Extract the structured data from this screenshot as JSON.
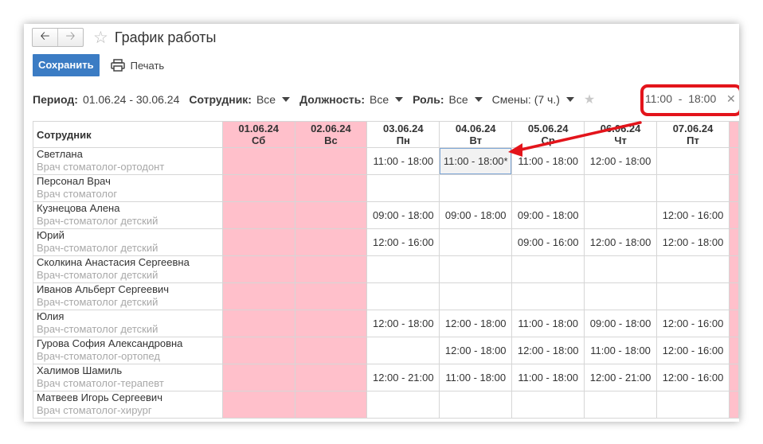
{
  "window": {
    "title": "График работы"
  },
  "toolbar": {
    "save_label": "Сохранить",
    "print_label": "Печать"
  },
  "filters": {
    "period_label": "Период:",
    "period_value": "01.06.24 - 30.06.24",
    "employee_label": "Сотрудник:",
    "employee_value": "Все",
    "position_label": "Должность:",
    "position_value": "Все",
    "role_label": "Роль:",
    "role_value": "Все",
    "shifts_value": "Смены: (7 ч.)",
    "time_value": "11:00  -  18:00"
  },
  "colors": {
    "accent": "#3b7cc4",
    "weekend": "#ffc0cb",
    "highlight": "#e3141b"
  },
  "table": {
    "header_employee": "Сотрудник",
    "days": [
      {
        "date": "01.06.24",
        "dow": "Сб"
      },
      {
        "date": "02.06.24",
        "dow": "Вс"
      },
      {
        "date": "03.06.24",
        "dow": "Пн"
      },
      {
        "date": "04.06.24",
        "dow": "Вт"
      },
      {
        "date": "05.06.24",
        "dow": "Ср"
      },
      {
        "date": "06.06.24",
        "dow": "Чт"
      },
      {
        "date": "07.06.24",
        "dow": "Пт"
      }
    ],
    "rows": [
      {
        "name": "Светлана",
        "position": "Врач стоматолог-ортодонт",
        "cells": [
          "",
          "",
          "11:00 - 18:00",
          "11:00 - 18:00*",
          "11:00 - 18:00",
          "12:00 - 18:00",
          ""
        ]
      },
      {
        "name": "Персонал Врач",
        "position": "Врач стоматолог",
        "cells": [
          "",
          "",
          "",
          "",
          "",
          "",
          ""
        ]
      },
      {
        "name": "Кузнецова Алена",
        "position": "Врач-стоматолог детский",
        "cells": [
          "",
          "",
          "09:00 - 18:00",
          "09:00 - 18:00",
          "09:00 - 18:00",
          "",
          "12:00 - 16:00"
        ]
      },
      {
        "name": "Юрий",
        "position": "Врач-стоматолог детский",
        "cells": [
          "",
          "",
          "12:00 - 16:00",
          "",
          "09:00 - 16:00",
          "12:00 - 18:00",
          "12:00 - 18:00"
        ]
      },
      {
        "name": "Сколкина Анастасия Сергеевна",
        "position": "Врач-стоматолог детский",
        "cells": [
          "",
          "",
          "",
          "",
          "",
          "",
          ""
        ]
      },
      {
        "name": "Иванов Альберт Сергеевич",
        "position": "Врач-стоматолог детский",
        "cells": [
          "",
          "",
          "",
          "",
          "",
          "",
          ""
        ]
      },
      {
        "name": "Юлия",
        "position": "Врач-стоматолог детский",
        "cells": [
          "",
          "",
          "12:00 - 18:00",
          "12:00 - 18:00",
          "11:00 - 18:00",
          "09:00 - 18:00",
          "12:00 - 16:00"
        ]
      },
      {
        "name": "Гурова София Александровна",
        "position": "Врач-стоматолог-ортопед",
        "cells": [
          "",
          "",
          "",
          "12:00 - 18:00",
          "12:00 - 18:00",
          "11:00 - 18:00",
          "12:00 - 16:00"
        ]
      },
      {
        "name": "Халимов Шамиль",
        "position": "Врач стоматолог-терапевт",
        "cells": [
          "",
          "",
          "12:00 - 21:00",
          "11:00 - 18:00",
          "11:00 - 18:00",
          "12:00 - 21:00",
          "12:00 - 16:00"
        ]
      },
      {
        "name": "Матвеев Игорь Сергеевич",
        "position": "Врач стоматолог-хирург",
        "cells": [
          "",
          "",
          "",
          "",
          "",
          "",
          ""
        ]
      }
    ]
  }
}
